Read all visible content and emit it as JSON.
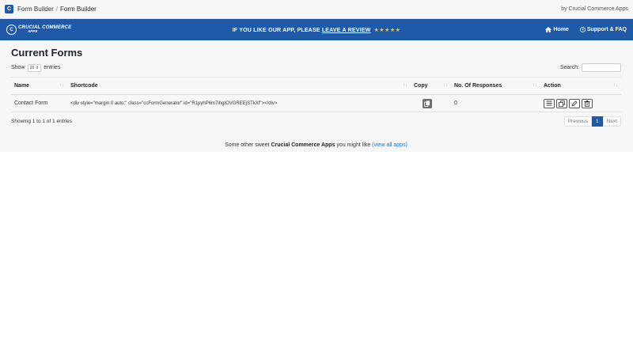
{
  "topbar": {
    "crumbs": [
      "Form Builder",
      "Form Builder"
    ],
    "separator": "/",
    "by": "by Crucial Commerce Apps"
  },
  "banner": {
    "brand_line1": "CRUCIAL COMMERCE",
    "brand_line2": "APPS",
    "promo_text": "IF YOU LIKE OUR APP, PLEASE ",
    "promo_link": "LEAVE A REVIEW",
    "stars": "★★★★★",
    "nav": [
      {
        "label": "Home",
        "icon": "home-icon"
      },
      {
        "label": "Support & FAQ",
        "icon": "question-circle-icon"
      }
    ]
  },
  "page": {
    "title": "Current Forms",
    "show_label": "Show",
    "show_value": "10",
    "entries_label": "entries",
    "search_label": "Search:",
    "search_value": ""
  },
  "table": {
    "columns": [
      "Name",
      "Shortcode",
      "Copy",
      "No. Of Responses",
      "Action"
    ],
    "sort_glyph": "↑↓",
    "rows": [
      {
        "name": "Contact Form",
        "shortcode": "<div style=\"margin:0 auto;\" class=\"ccFormGenerator\" id=\"R1pyhP6m7ihgIOVGREEjSTkXf\"></div>",
        "responses": "0"
      }
    ]
  },
  "footer": {
    "info": "Showing 1 to 1 of 1 entries",
    "prev": "Previous",
    "page": "1",
    "next": "Next"
  },
  "other_apps": {
    "prefix": "Some other sweet ",
    "brand": "Crucial Commerce Apps",
    "middle": " you might like ",
    "link": "(view all apps)"
  },
  "colors": {
    "brand_blue": "#1e5aa8",
    "stars": "#f5c518",
    "link": "#1e73be"
  }
}
